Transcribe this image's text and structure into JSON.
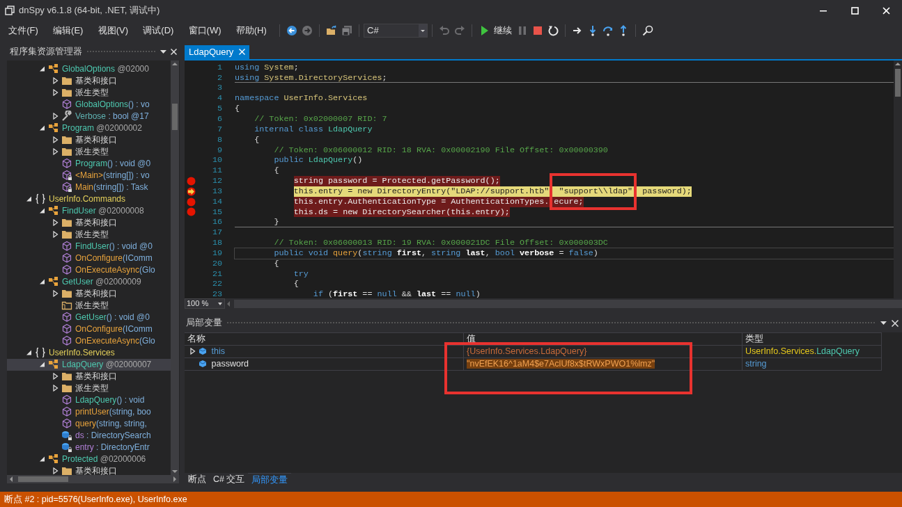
{
  "window": {
    "title": "dnSpy v6.1.8 (64-bit, .NET, 调试中)"
  },
  "menu": [
    "文件(F)",
    "编辑(E)",
    "视图(V)",
    "调试(D)",
    "窗口(W)",
    "帮助(H)"
  ],
  "toolbar": [
    [
      {
        "kind": "back",
        "disabled": false
      },
      {
        "kind": "forward",
        "disabled": true
      }
    ],
    [
      {
        "kind": "open",
        "disabled": false
      },
      {
        "kind": "save",
        "disabled": true
      }
    ],
    [
      {
        "kind": "combo",
        "value": "C#"
      }
    ],
    [
      {
        "kind": "undo",
        "disabled": true
      },
      {
        "kind": "redo",
        "disabled": true
      }
    ],
    [
      {
        "kind": "run",
        "label": "继续",
        "disabled": false
      },
      {
        "kind": "pause",
        "disabled": true
      },
      {
        "kind": "stop",
        "disabled": false
      },
      {
        "kind": "restart",
        "disabled": false
      }
    ],
    [
      {
        "kind": "next",
        "disabled": false
      },
      {
        "kind": "step-into",
        "disabled": false
      },
      {
        "kind": "step-over",
        "disabled": false
      },
      {
        "kind": "step-out",
        "disabled": false
      }
    ],
    [
      {
        "kind": "search",
        "disabled": false
      }
    ]
  ],
  "explorer": {
    "title": "程序集资源管理器",
    "tree": [
      {
        "kind": "hidden",
        "children": [
          {
            "kind": "class",
            "name": "GlobalOptions",
            "suffix": " @02000",
            "expanded": true,
            "selected": false,
            "children": [
              {
                "kind": "folder",
                "name": "基类和接口",
                "expanded": false,
                "selected": false
              },
              {
                "kind": "folder",
                "name": "派生类型",
                "expanded": false,
                "selected": false
              },
              {
                "kind": "constructor",
                "name": "GlobalOptions",
                "suffix": "() : vo",
                "locked": false,
                "selected": false
              },
              {
                "kind": "property",
                "name": "Verbose",
                "suffix": " : bool @17",
                "expanded": false,
                "selected": false
              }
            ]
          },
          {
            "kind": "class",
            "name": "Program",
            "suffix": " @02000002",
            "expanded": true,
            "selected": false,
            "children": [
              {
                "kind": "folder",
                "name": "基类和接口",
                "expanded": false,
                "selected": false
              },
              {
                "kind": "folder",
                "name": "派生类型",
                "expanded": false,
                "selected": false
              },
              {
                "kind": "constructor",
                "name": "Program",
                "suffix": "() : void @0",
                "locked": false,
                "selected": false
              },
              {
                "kind": "method",
                "name": "<Main>",
                "suffix": "(string[]) : vo",
                "locked": true,
                "selected": false
              },
              {
                "kind": "method",
                "name": "Main",
                "suffix": "(string[]) : Task",
                "locked": true,
                "selected": false
              }
            ]
          }
        ]
      },
      {
        "kind": "namespace",
        "name": "UserInfo.Commands",
        "expanded": true,
        "selected": false,
        "children": [
          {
            "kind": "class",
            "name": "FindUser",
            "suffix": " @02000008",
            "expanded": true,
            "selected": false,
            "children": [
              {
                "kind": "folder",
                "name": "基类和接口",
                "expanded": false,
                "selected": false
              },
              {
                "kind": "folder",
                "name": "派生类型",
                "expanded": false,
                "selected": false
              },
              {
                "kind": "constructor",
                "name": "FindUser",
                "suffix": "() : void @0",
                "locked": false,
                "selected": false
              },
              {
                "kind": "method",
                "name": "OnConfigure",
                "suffix": "(IComm",
                "locked": false,
                "selected": false
              },
              {
                "kind": "method",
                "name": "OnExecuteAsync",
                "suffix": "(Glo",
                "locked": false,
                "selected": false
              }
            ]
          },
          {
            "kind": "class",
            "name": "GetUser",
            "suffix": " @02000009",
            "expanded": true,
            "selected": false,
            "children": [
              {
                "kind": "folder",
                "name": "基类和接口",
                "expanded": false,
                "selected": false
              },
              {
                "kind": "empty-folder",
                "name": "派生类型",
                "selected": false
              },
              {
                "kind": "constructor",
                "name": "GetUser",
                "suffix": "() : void @0",
                "locked": false,
                "selected": false
              },
              {
                "kind": "method",
                "name": "OnConfigure",
                "suffix": "(IComm",
                "locked": false,
                "selected": false
              },
              {
                "kind": "method",
                "name": "OnExecuteAsync",
                "suffix": "(Glo",
                "locked": false,
                "selected": false
              }
            ]
          }
        ]
      },
      {
        "kind": "namespace",
        "name": "UserInfo.Services",
        "expanded": true,
        "selected": false,
        "children": [
          {
            "kind": "class",
            "name": "LdapQuery",
            "suffix": " @02000007",
            "expanded": true,
            "selected": true,
            "children": [
              {
                "kind": "folder",
                "name": "基类和接口",
                "expanded": false,
                "selected": false
              },
              {
                "kind": "folder",
                "name": "派生类型",
                "expanded": false,
                "selected": false
              },
              {
                "kind": "constructor",
                "name": "LdapQuery",
                "suffix": "() : void",
                "locked": false,
                "selected": false
              },
              {
                "kind": "method",
                "name": "printUser",
                "suffix": "(string, boo",
                "locked": false,
                "selected": false
              },
              {
                "kind": "method",
                "name": "query",
                "suffix": "(string, string,",
                "locked": false,
                "selected": false
              },
              {
                "kind": "field",
                "name": "ds",
                "suffix": " : DirectorySearch",
                "locked": true,
                "selected": false
              },
              {
                "kind": "field",
                "name": "entry",
                "suffix": " : DirectoryEntr",
                "locked": true,
                "selected": false
              }
            ]
          },
          {
            "kind": "class",
            "name": "Protected",
            "suffix": " @02000006",
            "expanded": true,
            "selected": false,
            "children": [
              {
                "kind": "folder",
                "name": "基类和接口",
                "expanded": false,
                "selected": false
              }
            ]
          }
        ]
      }
    ]
  },
  "editor": {
    "tab": {
      "label": "LdapQuery",
      "selected": true
    },
    "zoom": "100 %",
    "lines": [
      {
        "num": "1",
        "breakpoint": false,
        "current": false,
        "caret": false,
        "rule": false,
        "tokens": [
          {
            "kind": "keyword",
            "text": "using "
          },
          {
            "kind": "namespace",
            "text": "System"
          },
          {
            "kind": "plain",
            "text": ";"
          }
        ]
      },
      {
        "num": "2",
        "breakpoint": false,
        "current": false,
        "caret": false,
        "rule": true,
        "tokens": [
          {
            "kind": "keyword",
            "text": "using "
          },
          {
            "kind": "namespace",
            "text": "System.DirectoryServices"
          },
          {
            "kind": "plain",
            "text": ";"
          }
        ]
      },
      {
        "num": "3",
        "breakpoint": false,
        "current": false,
        "caret": false,
        "rule": false
      },
      {
        "num": "4",
        "breakpoint": false,
        "current": false,
        "caret": false,
        "rule": false,
        "tokens": [
          {
            "kind": "keyword",
            "text": "namespace "
          },
          {
            "kind": "namespace",
            "text": "UserInfo.Services"
          }
        ]
      },
      {
        "num": "5",
        "breakpoint": false,
        "current": false,
        "caret": false,
        "rule": false,
        "tokens": [
          {
            "kind": "plain",
            "text": "{"
          }
        ]
      },
      {
        "num": "6",
        "breakpoint": false,
        "current": false,
        "caret": false,
        "rule": false,
        "tokens": [
          {
            "kind": "comment",
            "text": "    // Token: 0x02000007 RID: 7"
          }
        ]
      },
      {
        "num": "7",
        "breakpoint": false,
        "current": false,
        "caret": false,
        "rule": false,
        "tokens": [
          {
            "kind": "keyword",
            "text": "    internal class "
          },
          {
            "kind": "type",
            "text": "LdapQuery"
          }
        ]
      },
      {
        "num": "8",
        "breakpoint": false,
        "current": false,
        "caret": false,
        "rule": false,
        "tokens": [
          {
            "kind": "plain",
            "text": "    {"
          }
        ]
      },
      {
        "num": "9",
        "breakpoint": false,
        "current": false,
        "caret": false,
        "rule": false,
        "tokens": [
          {
            "kind": "comment",
            "text": "        // Token: 0x06000012 RID: 18 RVA: 0x00002190 File Offset: 0x00000390"
          }
        ]
      },
      {
        "num": "10",
        "breakpoint": false,
        "current": false,
        "caret": false,
        "rule": false,
        "tokens": [
          {
            "kind": "keyword",
            "text": "        public "
          },
          {
            "kind": "type",
            "text": "LdapQuery"
          },
          {
            "kind": "plain",
            "text": "()"
          }
        ]
      },
      {
        "num": "11",
        "breakpoint": false,
        "current": false,
        "caret": false,
        "rule": false,
        "tokens": [
          {
            "kind": "plain",
            "text": "        {"
          }
        ]
      },
      {
        "num": "12",
        "breakpoint": true,
        "current": false,
        "caret": false,
        "rule": false,
        "tokens": [
          {
            "kind": "plain",
            "text": "            string password = Protected.getPassword();"
          }
        ]
      },
      {
        "num": "13",
        "breakpoint": true,
        "current": true,
        "caret": false,
        "rule": false,
        "tokens": [
          {
            "kind": "plain",
            "text": "            this.entry = new DirectoryEntry(\"LDAP://support.htb\""
          },
          {
            "kind": "covered"
          },
          {
            "kind": "plain",
            "text": " \"support\\\\ldap\""
          },
          {
            "kind": "covered"
          },
          {
            "kind": "plain",
            "text": " password);"
          }
        ]
      },
      {
        "num": "14",
        "breakpoint": true,
        "current": false,
        "caret": false,
        "rule": false,
        "tokens": [
          {
            "kind": "plain",
            "text": "            this.entry.AuthenticationType = AuthenticationTypes."
          },
          {
            "kind": "covered"
          },
          {
            "kind": "plain",
            "text": "ecure;"
          }
        ]
      },
      {
        "num": "15",
        "breakpoint": true,
        "current": false,
        "caret": false,
        "rule": false,
        "tokens": [
          {
            "kind": "plain",
            "text": "            this.ds = new DirectorySearcher(this.entry);"
          }
        ]
      },
      {
        "num": "16",
        "breakpoint": false,
        "current": false,
        "caret": false,
        "rule": true,
        "tokens": [
          {
            "kind": "plain",
            "text": "        }"
          }
        ]
      },
      {
        "num": "17",
        "breakpoint": false,
        "current": false,
        "caret": false,
        "rule": false
      },
      {
        "num": "18",
        "breakpoint": false,
        "current": false,
        "caret": false,
        "rule": false,
        "tokens": [
          {
            "kind": "comment",
            "text": "        // Token: 0x06000013 RID: 19 RVA: 0x000021DC File Offset: 0x000003DC"
          }
        ]
      },
      {
        "num": "19",
        "breakpoint": false,
        "current": false,
        "caret": true,
        "rule": false,
        "tokens": [
          {
            "kind": "keyword",
            "text": "        public void "
          },
          {
            "kind": "method",
            "text": "query"
          },
          {
            "kind": "plain",
            "text": "("
          },
          {
            "kind": "keyword",
            "text": "string "
          },
          {
            "kind": "param",
            "text": "first"
          },
          {
            "kind": "plain",
            "text": ", "
          },
          {
            "kind": "keyword",
            "text": "string "
          },
          {
            "kind": "param",
            "text": "last"
          },
          {
            "kind": "plain",
            "text": ", "
          },
          {
            "kind": "keyword",
            "text": "bool "
          },
          {
            "kind": "param",
            "text": "verbose"
          },
          {
            "kind": "plain",
            "text": " = "
          },
          {
            "kind": "keyword",
            "text": "false"
          },
          {
            "kind": "plain",
            "text": ")"
          }
        ]
      },
      {
        "num": "20",
        "breakpoint": false,
        "current": false,
        "caret": false,
        "rule": false,
        "tokens": [
          {
            "kind": "plain",
            "text": "        {"
          }
        ]
      },
      {
        "num": "21",
        "breakpoint": false,
        "current": false,
        "caret": false,
        "rule": false,
        "tokens": [
          {
            "kind": "keyword",
            "text": "            try"
          }
        ]
      },
      {
        "num": "22",
        "breakpoint": false,
        "current": false,
        "caret": false,
        "rule": false,
        "tokens": [
          {
            "kind": "plain",
            "text": "            {"
          }
        ]
      },
      {
        "num": "23",
        "breakpoint": false,
        "current": false,
        "caret": false,
        "rule": false,
        "tokens": [
          {
            "kind": "keyword",
            "text": "                if "
          },
          {
            "kind": "plain",
            "text": "("
          },
          {
            "kind": "param",
            "text": "first"
          },
          {
            "kind": "plain",
            "text": " == "
          },
          {
            "kind": "keyword",
            "text": "null"
          },
          {
            "kind": "plain",
            "text": " && "
          },
          {
            "kind": "param",
            "text": "last"
          },
          {
            "kind": "plain",
            "text": " == "
          },
          {
            "kind": "keyword",
            "text": "null"
          },
          {
            "kind": "plain",
            "text": ")"
          }
        ]
      }
    ]
  },
  "locals": {
    "title": "局部变量",
    "columns": [
      "名称",
      "值",
      "类型"
    ],
    "rows": [
      {
        "kind": "object",
        "name": "this",
        "expanded": false,
        "value": "{UserInfo.Services.LdapQuery}",
        "highlighted": false,
        "type": [
          {
            "kind": "namespace",
            "text": "UserInfo.Services."
          },
          {
            "kind": "type",
            "text": "LdapQuery"
          }
        ]
      },
      {
        "kind": "string",
        "name": "password",
        "value": "\"nvEfEK16^1aM4$e7AclUf8x$tRWxPWO1%lmz\"",
        "highlighted": true,
        "type": [
          {
            "kind": "keyword",
            "text": "string"
          }
        ]
      }
    ]
  },
  "bottom_tabs": [
    {
      "label": "断点",
      "selected": false
    },
    {
      "label": "C# 交互",
      "selected": false
    },
    {
      "label": "局部变量",
      "selected": true
    }
  ],
  "status_bar": "断点 #2 : pid=5576(UserInfo.exe), UserInfo.exe"
}
